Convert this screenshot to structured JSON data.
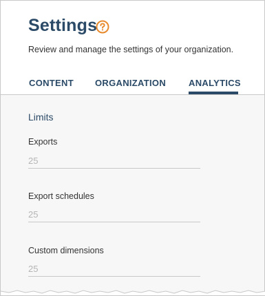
{
  "header": {
    "title": "Settings",
    "subtitle": "Review and manage the settings of your organization."
  },
  "tabs": [
    {
      "label": "CONTENT",
      "active": false
    },
    {
      "label": "ORGANIZATION",
      "active": false
    },
    {
      "label": "ANALYTICS",
      "active": true
    }
  ],
  "limits": {
    "section_title": "Limits",
    "fields": [
      {
        "label": "Exports",
        "placeholder": "25"
      },
      {
        "label": "Export schedules",
        "placeholder": "25"
      },
      {
        "label": "Custom dimensions",
        "placeholder": "25"
      }
    ]
  },
  "colors": {
    "primary": "#2b4a67",
    "help_accent": "#e8892b",
    "body_bg": "#f7f7f7"
  },
  "icons": {
    "help": "question-circle-icon"
  }
}
